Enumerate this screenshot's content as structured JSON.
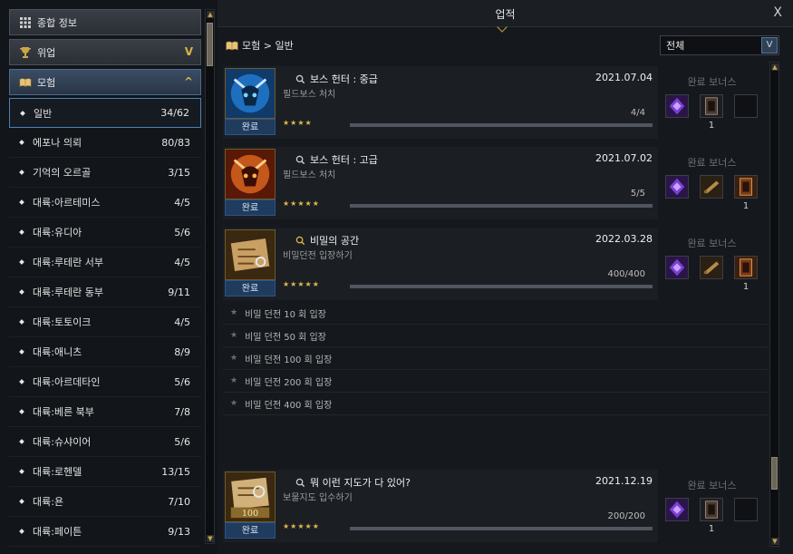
{
  "left": {
    "categories": [
      {
        "label": "종합 정보",
        "icon": "grid-icon"
      },
      {
        "label": "위업",
        "icon": "trophy-icon",
        "chevron": "V"
      },
      {
        "label": "모험",
        "icon": "book-icon",
        "chevron": "^"
      }
    ],
    "items": [
      {
        "label": "일반",
        "count": "34/62",
        "active": true
      },
      {
        "label": "에포나 의뢰",
        "count": "80/83"
      },
      {
        "label": "기억의 오르골",
        "count": "3/15"
      },
      {
        "label": "대륙:아르테미스",
        "count": "4/5"
      },
      {
        "label": "대륙:유디아",
        "count": "5/6"
      },
      {
        "label": "대륙:루테란 서부",
        "count": "4/5"
      },
      {
        "label": "대륙:루테란 동부",
        "count": "9/11"
      },
      {
        "label": "대륙:토토이크",
        "count": "4/5"
      },
      {
        "label": "대륙:애니츠",
        "count": "8/9"
      },
      {
        "label": "대륙:아르데타인",
        "count": "5/6"
      },
      {
        "label": "대륙:베른 북부",
        "count": "7/8"
      },
      {
        "label": "대륙:슈샤이어",
        "count": "5/6"
      },
      {
        "label": "대륙:로헨델",
        "count": "13/15"
      },
      {
        "label": "대륙:욘",
        "count": "7/10"
      },
      {
        "label": "대륙:페이튼",
        "count": "9/13"
      }
    ]
  },
  "header": {
    "title": "업적",
    "close": "X",
    "breadcrumb": "모험 > 일반",
    "filter": "전체"
  },
  "achievements": [
    {
      "name": "보스 헌터 : 중급",
      "desc": "필드보스 처치",
      "date": "2021.07.04",
      "progress": "4/4",
      "fraction": 1.0,
      "stars": "★★★★",
      "status": "완료",
      "bonus_label": "완료 보너스",
      "slots": [
        {
          "q": ""
        },
        {
          "q": "1"
        },
        {
          "q": ""
        }
      ]
    },
    {
      "name": "보스 헌터 : 고급",
      "desc": "필드보스 처치",
      "date": "2021.07.02",
      "progress": "5/5",
      "fraction": 1.0,
      "stars": "★★★★★",
      "status": "완료",
      "bonus_label": "완료 보너스",
      "slots": [
        {
          "q": ""
        },
        {
          "q": ""
        },
        {
          "q": "1"
        }
      ]
    },
    {
      "name": "비밀의 공간",
      "desc": "비밀던전 입장하기",
      "date": "2022.03.28",
      "progress": "400/400",
      "fraction": 1.0,
      "stars": "★★★★★",
      "status": "완료",
      "bonus_label": "완료 보너스",
      "slots": [
        {
          "q": ""
        },
        {
          "q": ""
        },
        {
          "q": "1"
        }
      ]
    },
    {
      "name": "뭐 이런 지도가 다 있어?",
      "desc": "보물지도 입수하기",
      "date": "2021.12.19",
      "progress": "200/200",
      "fraction": 1.0,
      "stars": "★★★★★",
      "status": "완료",
      "bonus_label": "완료 보너스",
      "slots": [
        {
          "q": ""
        },
        {
          "q": "1"
        },
        {
          "q": ""
        }
      ]
    }
  ],
  "steps": [
    "비밀 던전 10 회 입장",
    "비밀 던전 50 회 입장",
    "비밀 던전 100 회 입장",
    "비밀 던전 200 회 입장",
    "비밀 던전 400 회 입장"
  ],
  "colors": {
    "accent_gold": "#d9b24a",
    "done_blue": "#1f3b5e",
    "active_border": "#4a82b7"
  }
}
